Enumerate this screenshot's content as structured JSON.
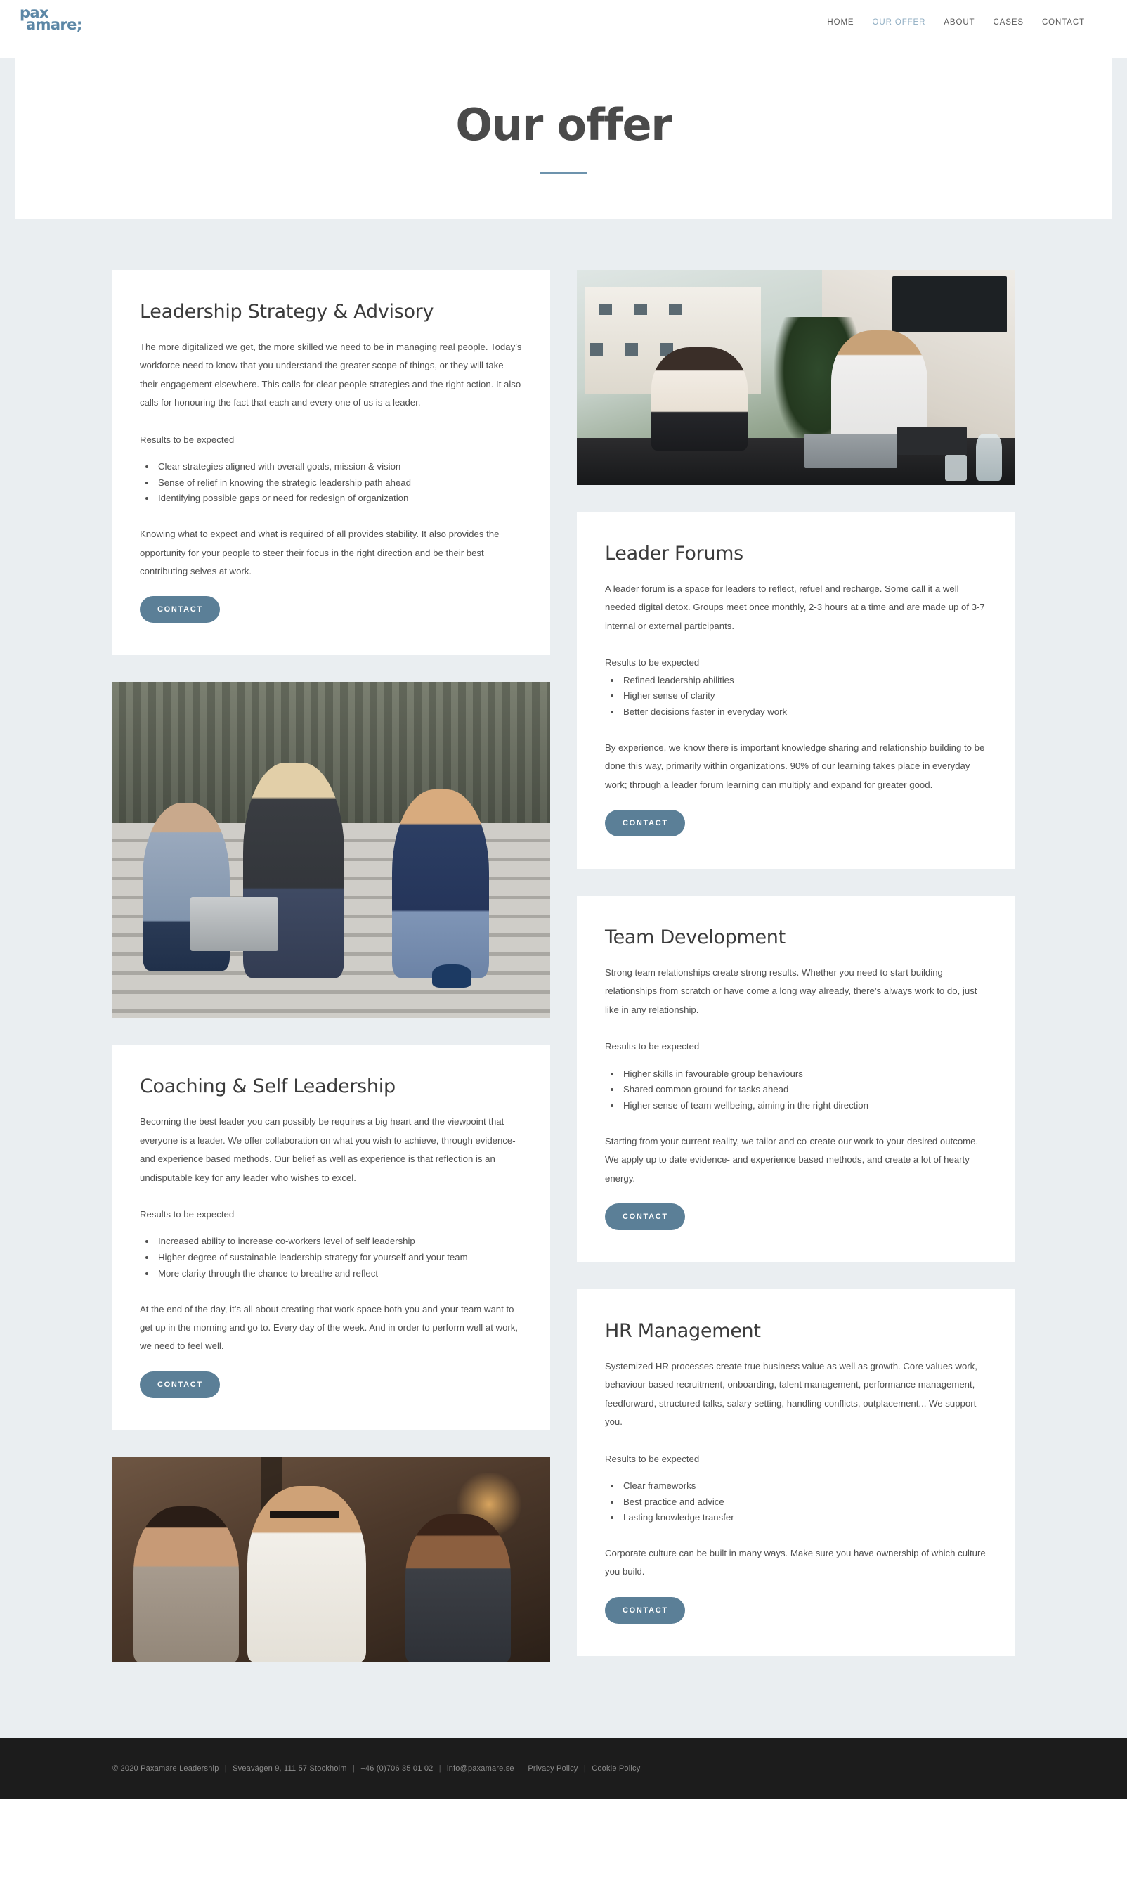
{
  "brand": {
    "logo_line1": "pax",
    "logo_line2": "amare;",
    "color": "#5c87a6"
  },
  "nav": {
    "items": [
      {
        "label": "HOME",
        "active": false
      },
      {
        "label": "OUR OFFER",
        "active": true
      },
      {
        "label": "ABOUT",
        "active": false
      },
      {
        "label": "CASES",
        "active": false
      },
      {
        "label": "CONTACT",
        "active": false
      }
    ]
  },
  "hero": {
    "title": "Our offer",
    "rule_color": "#6d93ad"
  },
  "theme": {
    "page_background": "#eaeef1",
    "card_background": "#ffffff",
    "button_color": "#5b7f97",
    "heading_color": "#3b3b3b",
    "body_text_color": "#4f4f4f"
  },
  "cards": {
    "leadership": {
      "title": "Leadership Strategy & Advisory",
      "lead": "The more digitalized we get, the more skilled we need to be in managing real people. Today’s workforce need to know that you understand the greater scope of things, or they will take their engagement elsewhere. This calls for clear people strategies and the right action. It also calls for honouring the fact that each and every one of us is a leader.",
      "results_label": "Results to be expected",
      "bullets": [
        "Clear strategies aligned with overall goals, mission & vision",
        "Sense of relief in knowing the strategic leadership path ahead",
        "Identifying possible gaps or need for redesign of organization"
      ],
      "closing": "Knowing what to expect and what is required of all provides stability. It also provides the opportunity for your people to steer their focus in the right direction and be their best contributing selves at work.",
      "button": "CONTACT"
    },
    "coaching": {
      "title": "Coaching & Self Leadership",
      "lead": "Becoming the best leader you can possibly be requires a big heart and the viewpoint that everyone is a leader. We offer collaboration on what you wish to achieve, through evidence- and experience based methods. Our belief as well as experience is that reflection is an undisputable key for any leader who wishes to excel.",
      "results_label": "Results to be expected",
      "bullets": [
        "Increased ability to increase co-workers level of self leadership",
        "Higher degree of sustainable leadership strategy for yourself and your team",
        "More clarity through the chance to breathe and reflect"
      ],
      "closing": "At the end of the day, it’s all about creating that work space both you and your team want to get up in the morning and go to. Every day of the week. And in order to perform well at work, we need to feel well.",
      "button": "CONTACT"
    },
    "leader_forums": {
      "title": "Leader Forums",
      "lead": "A leader forum is a space for leaders to reflect, refuel and recharge. Some call it a well needed digital detox. Groups meet once monthly, 2-3 hours at a time and are made up of 3-7 internal or external participants.",
      "results_label": "Results to be expected",
      "bullets": [
        "Refined leadership abilities",
        "Higher sense of clarity",
        "Better decisions faster in everyday work"
      ],
      "closing": "By experience, we know there is important knowledge sharing and relationship building to be done this way, primarily within organizations. 90% of our learning takes place in everyday work; through a leader forum learning can multiply and expand for greater good.",
      "button": "CONTACT"
    },
    "team_development": {
      "title": "Team Development",
      "lead": "Strong team relationships create strong results. Whether you need to start building relationships from scratch or have come a long way already, there’s always work to do, just like in any relationship.",
      "results_label": "Results to be expected",
      "bullets": [
        "Higher skills in favourable group behaviours",
        "Shared common ground for tasks ahead",
        "Higher sense of team wellbeing, aiming in the right direction"
      ],
      "closing": "Starting from your current reality, we tailor and co-create our work to your desired outcome. We apply up to date evidence- and experience based methods, and create a lot of hearty energy.",
      "button": "CONTACT"
    },
    "hr_management": {
      "title": "HR Management",
      "lead": "Systemized HR processes create true business value as well as growth. Core values work, behaviour based recruitment, onboarding, talent management, performance management, feedforward, structured talks, salary setting, handling conflicts, outplacement... We support you.",
      "results_label": "Results to be expected",
      "bullets": [
        "Clear frameworks",
        "Best practice and advice",
        "Lasting knowledge transfer"
      ],
      "closing": "Corporate culture can be built in many ways. Make sure you have ownership of which culture you build.",
      "button": "CONTACT"
    }
  },
  "photos": {
    "meeting_window": "photo-two-colleagues-at-desk-by-window",
    "steps_group": "photo-three-people-on-steps-with-laptop",
    "workshop_group": "photo-three-people-in-conversation"
  },
  "footer": {
    "copyright": "© 2020 Paxamare Leadership",
    "address": "Sveavägen 9, 111 57 Stockholm",
    "phone": "+46 (0)706 35 01 02",
    "email": "info@paxamare.se",
    "privacy": "Privacy Policy",
    "cookie": "Cookie Policy"
  }
}
